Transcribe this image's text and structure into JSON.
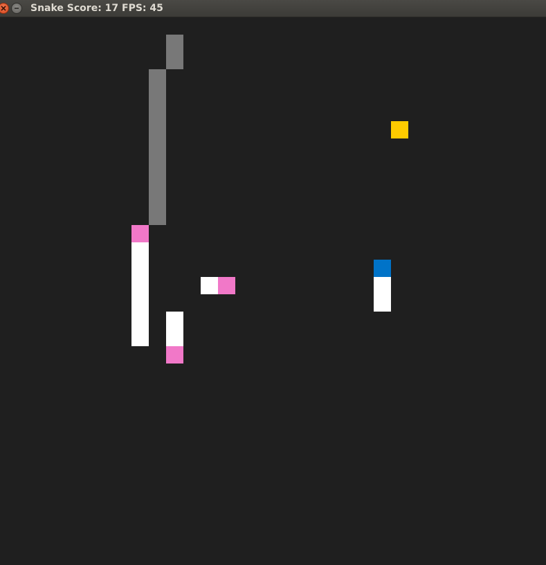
{
  "window": {
    "title": "Snake Score: 17 FPS: 45"
  },
  "game": {
    "background_color": "#1f1f1f",
    "colors": {
      "wall": "#787878",
      "snake_body": "#ffffff",
      "snake_tail": "#f178c8",
      "player_head": "#0073c8",
      "food": "#ffcb00"
    }
  }
}
